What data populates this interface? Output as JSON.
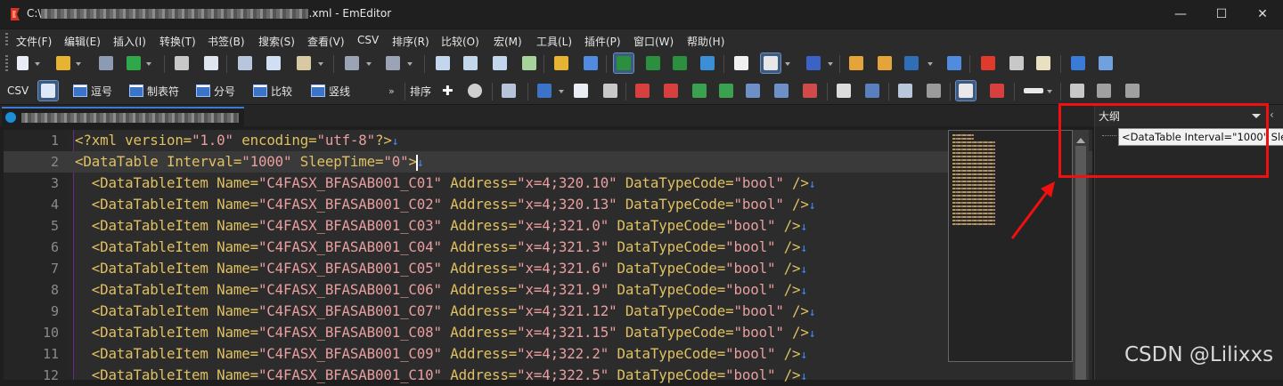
{
  "window": {
    "title_prefix": "C:\\",
    "title_suffix": ".xml - EmEditor",
    "minimize_glyph": "—",
    "maximize_glyph": "☐",
    "close_glyph": "✕"
  },
  "menu": [
    "文件(F)",
    "编辑(E)",
    "插入(I)",
    "转换(T)",
    "书签(B)",
    "搜索(S)",
    "查看(V)",
    "CSV",
    "排序(R)",
    "比较(O)",
    "宏(M)",
    "工具(L)",
    "插件(P)",
    "窗口(W)",
    "帮助(H)"
  ],
  "csv_toolbar": {
    "csv_label": "CSV",
    "buttons": [
      "逗号",
      "制表符",
      "分号",
      "比较",
      "竖线"
    ],
    "sort_label": "排序",
    "plus_glyph": "✚"
  },
  "editor": {
    "lines": [
      {
        "n": "1",
        "segs": [
          {
            "c": "pi",
            "t": "<?xml version="
          },
          {
            "c": "val",
            "t": "\"1.0\""
          },
          {
            "c": "pi",
            "t": " encoding="
          },
          {
            "c": "val",
            "t": "\"utf-8\""
          },
          {
            "c": "pi",
            "t": "?>"
          }
        ]
      },
      {
        "n": "2",
        "segs": [
          {
            "c": "tag",
            "t": "<DataTable Interval="
          },
          {
            "c": "val",
            "t": "\"1000\""
          },
          {
            "c": "tag",
            "t": " SleepTime="
          },
          {
            "c": "val",
            "t": "\"0\""
          },
          {
            "c": "tag",
            "t": ">"
          }
        ]
      },
      {
        "n": "3",
        "segs": [
          {
            "c": "tag",
            "t": "  <DataTableItem Name="
          },
          {
            "c": "val",
            "t": "\"C4FASX_BFASAB001_C01\""
          },
          {
            "c": "tag",
            "t": " Address="
          },
          {
            "c": "val",
            "t": "\"x=4;320.10\""
          },
          {
            "c": "tag",
            "t": " DataTypeCode="
          },
          {
            "c": "val",
            "t": "\"bool\""
          },
          {
            "c": "tag",
            "t": " />"
          }
        ]
      },
      {
        "n": "4",
        "segs": [
          {
            "c": "tag",
            "t": "  <DataTableItem Name="
          },
          {
            "c": "val",
            "t": "\"C4FASX_BFASAB001_C02\""
          },
          {
            "c": "tag",
            "t": " Address="
          },
          {
            "c": "val",
            "t": "\"x=4;320.13\""
          },
          {
            "c": "tag",
            "t": " DataTypeCode="
          },
          {
            "c": "val",
            "t": "\"bool\""
          },
          {
            "c": "tag",
            "t": " />"
          }
        ]
      },
      {
        "n": "5",
        "segs": [
          {
            "c": "tag",
            "t": "  <DataTableItem Name="
          },
          {
            "c": "val",
            "t": "\"C4FASX_BFASAB001_C03\""
          },
          {
            "c": "tag",
            "t": " Address="
          },
          {
            "c": "val",
            "t": "\"x=4;321.0\""
          },
          {
            "c": "tag",
            "t": " DataTypeCode="
          },
          {
            "c": "val",
            "t": "\"bool\""
          },
          {
            "c": "tag",
            "t": " />"
          }
        ]
      },
      {
        "n": "6",
        "segs": [
          {
            "c": "tag",
            "t": "  <DataTableItem Name="
          },
          {
            "c": "val",
            "t": "\"C4FASX_BFASAB001_C04\""
          },
          {
            "c": "tag",
            "t": " Address="
          },
          {
            "c": "val",
            "t": "\"x=4;321.3\""
          },
          {
            "c": "tag",
            "t": " DataTypeCode="
          },
          {
            "c": "val",
            "t": "\"bool\""
          },
          {
            "c": "tag",
            "t": " />"
          }
        ]
      },
      {
        "n": "7",
        "segs": [
          {
            "c": "tag",
            "t": "  <DataTableItem Name="
          },
          {
            "c": "val",
            "t": "\"C4FASX_BFASAB001_C05\""
          },
          {
            "c": "tag",
            "t": " Address="
          },
          {
            "c": "val",
            "t": "\"x=4;321.6\""
          },
          {
            "c": "tag",
            "t": " DataTypeCode="
          },
          {
            "c": "val",
            "t": "\"bool\""
          },
          {
            "c": "tag",
            "t": " />"
          }
        ]
      },
      {
        "n": "8",
        "segs": [
          {
            "c": "tag",
            "t": "  <DataTableItem Name="
          },
          {
            "c": "val",
            "t": "\"C4FASX_BFASAB001_C06\""
          },
          {
            "c": "tag",
            "t": " Address="
          },
          {
            "c": "val",
            "t": "\"x=4;321.9\""
          },
          {
            "c": "tag",
            "t": " DataTypeCode="
          },
          {
            "c": "val",
            "t": "\"bool\""
          },
          {
            "c": "tag",
            "t": " />"
          }
        ]
      },
      {
        "n": "9",
        "segs": [
          {
            "c": "tag",
            "t": "  <DataTableItem Name="
          },
          {
            "c": "val",
            "t": "\"C4FASX_BFASAB001_C07\""
          },
          {
            "c": "tag",
            "t": " Address="
          },
          {
            "c": "val",
            "t": "\"x=4;321.12\""
          },
          {
            "c": "tag",
            "t": " DataTypeCode="
          },
          {
            "c": "val",
            "t": "\"bool\""
          },
          {
            "c": "tag",
            "t": " />"
          }
        ]
      },
      {
        "n": "10",
        "segs": [
          {
            "c": "tag",
            "t": "  <DataTableItem Name="
          },
          {
            "c": "val",
            "t": "\"C4FASX_BFASAB001_C08\""
          },
          {
            "c": "tag",
            "t": " Address="
          },
          {
            "c": "val",
            "t": "\"x=4;321.15\""
          },
          {
            "c": "tag",
            "t": " DataTypeCode="
          },
          {
            "c": "val",
            "t": "\"bool\""
          },
          {
            "c": "tag",
            "t": " />"
          }
        ]
      },
      {
        "n": "11",
        "segs": [
          {
            "c": "tag",
            "t": "  <DataTableItem Name="
          },
          {
            "c": "val",
            "t": "\"C4FASX_BFASAB001_C09\""
          },
          {
            "c": "tag",
            "t": " Address="
          },
          {
            "c": "val",
            "t": "\"x=4;322.2\""
          },
          {
            "c": "tag",
            "t": " DataTypeCode="
          },
          {
            "c": "val",
            "t": "\"bool\""
          },
          {
            "c": "tag",
            "t": " />"
          }
        ]
      },
      {
        "n": "12",
        "segs": [
          {
            "c": "tag",
            "t": "  <DataTableItem Name="
          },
          {
            "c": "val",
            "t": "\"C4FASX_BFASAB001_C10\""
          },
          {
            "c": "tag",
            "t": " Address="
          },
          {
            "c": "val",
            "t": "\"x=4;322.5\""
          },
          {
            "c": "tag",
            "t": " DataTypeCode="
          },
          {
            "c": "val",
            "t": "\"bool\""
          },
          {
            "c": "tag",
            "t": " />"
          }
        ]
      }
    ],
    "newline_glyph": "↓",
    "current_line": "2"
  },
  "outline": {
    "title": "大纲",
    "close_glyph": "‹",
    "item": "<DataTable Interval=\"1000\" Sle"
  },
  "watermark": "CSDN @Lilixxs",
  "colors": {
    "highlight_box": "#f01010",
    "xml_tag": "#e0c060",
    "xml_value": "#e99ea0",
    "newline_mark": "#3f8fff"
  }
}
